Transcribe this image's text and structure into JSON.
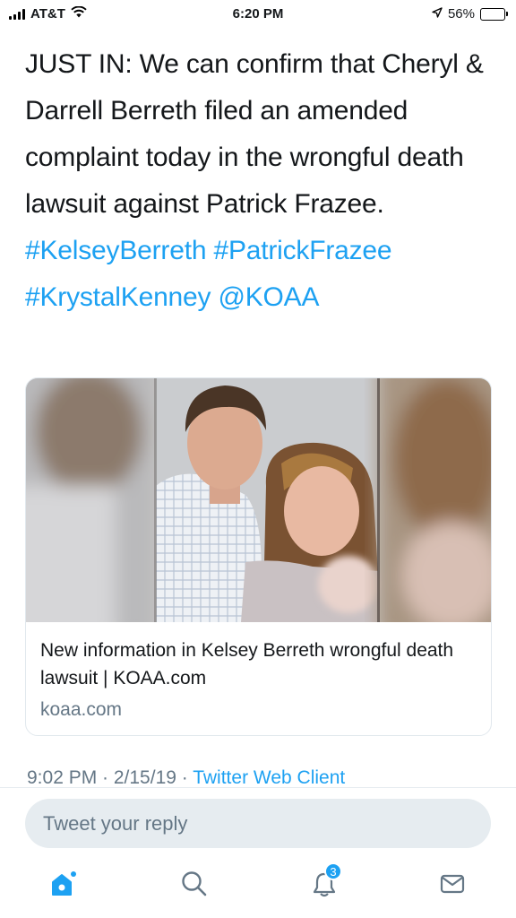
{
  "status_bar": {
    "carrier": "AT&T",
    "time": "6:20 PM",
    "battery": "56%",
    "battery_level": 0.56
  },
  "tweet": {
    "text_plain": "JUST IN: We can confirm that Cheryl & Darrell Berreth filed an amended complaint today in the wrongful death lawsuit against Patrick Frazee.",
    "links": [
      "#KelseyBerreth",
      "#PatrickFrazee",
      "#KrystalKenney",
      "@KOAA"
    ]
  },
  "card": {
    "title": "New information in Kelsey Berreth wrongful death lawsuit | KOAA.com",
    "domain": "koaa.com"
  },
  "meta": {
    "timestamp": "9:02 PM · 2/15/19 · ",
    "client": "Twitter Web Client"
  },
  "reply": {
    "placeholder": "Tweet your reply"
  },
  "tabbar": {
    "notifications_count": "3",
    "icons": [
      "home-icon",
      "search-icon",
      "notifications-icon",
      "messages-icon"
    ]
  },
  "colors": {
    "link": "#1da1f2",
    "text": "#14171a",
    "secondary": "#657786",
    "input_bg": "#e6ecf0"
  }
}
